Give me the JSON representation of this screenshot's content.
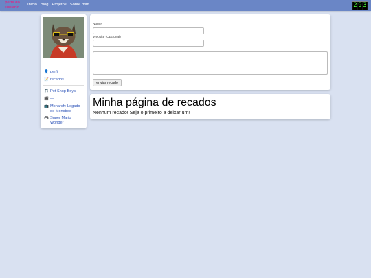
{
  "header": {
    "brand": "perfil do usuario",
    "nav": [
      "Início",
      "Blog",
      "Projetos",
      "Sobre mim"
    ],
    "counter": [
      "2",
      "9",
      "3"
    ]
  },
  "sidebar": {
    "links": [
      {
        "icon": "👤",
        "label": "perfil"
      },
      {
        "icon": "📝",
        "label": "recados"
      }
    ],
    "status": [
      {
        "icon": "🎵",
        "label": "Pet Shop Boys"
      },
      {
        "icon": "🎬",
        "label": "—"
      },
      {
        "icon": "📺",
        "label": "Monarch: Legado de Monstros"
      },
      {
        "icon": "🎮",
        "label": "Super Mario Wonder"
      }
    ]
  },
  "form": {
    "name_label": "Nome",
    "website_label": "Website (Opcional)",
    "submit_label": "enviar recado"
  },
  "messages": {
    "title": "Minha página de recados",
    "empty_text": "Nenhum recado! Seja o primeiro a deixar um!"
  },
  "colors": {
    "topbar": "#6a86c6",
    "background": "#d9e1f1",
    "link": "#2d54b8",
    "brand": "#d0308c"
  }
}
